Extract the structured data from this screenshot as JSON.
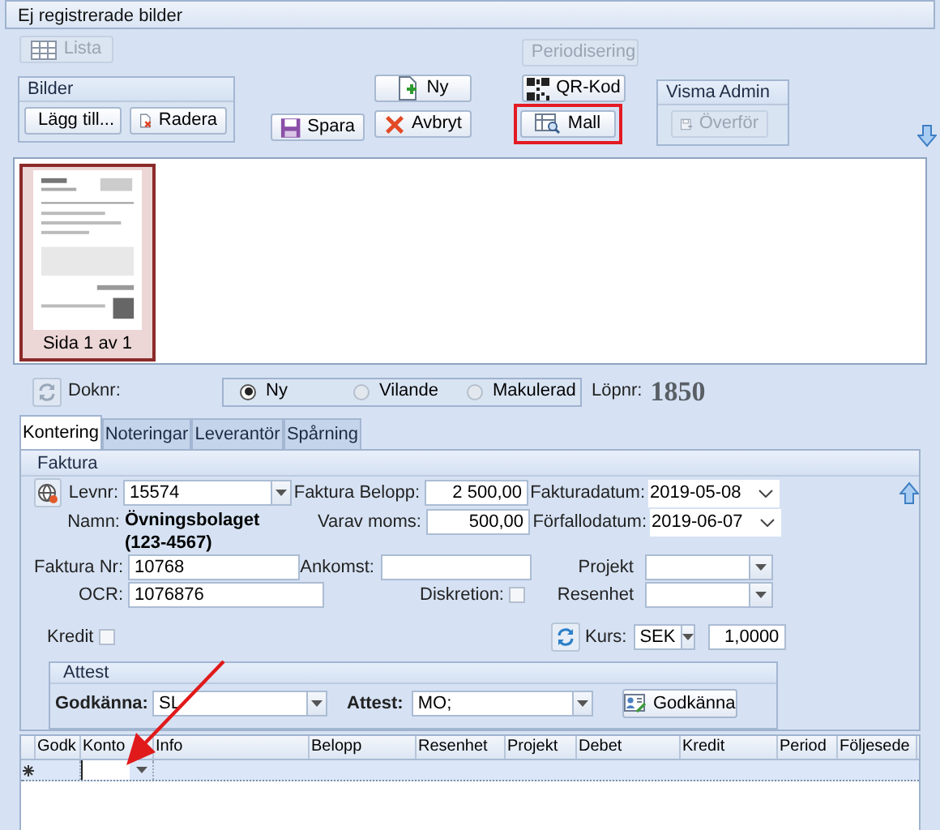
{
  "window": {
    "title": "Ej registrerade bilder"
  },
  "toolbar": {
    "lista": {
      "label": "Lista",
      "disabled": true
    },
    "bilder": {
      "title": "Bilder",
      "lagg_till": {
        "label": "Lägg till...",
        "disabled": false
      },
      "radera": {
        "label": "Radera",
        "disabled": false
      }
    },
    "spara": {
      "label": "Spara",
      "disabled": false
    },
    "ny": {
      "label": "Ny",
      "disabled": false
    },
    "avbryt": {
      "label": "Avbryt",
      "disabled": false
    },
    "periodisering": {
      "label": "Periodisering",
      "disabled": true
    },
    "qr_kod": {
      "label": "QR-Kod",
      "disabled": false
    },
    "mall": {
      "label": "Mall",
      "disabled": false,
      "highlighted": true
    },
    "visma_admin": {
      "title": "Visma Admin",
      "overfor": {
        "label": "Överför",
        "disabled": true
      }
    }
  },
  "preview": {
    "pages": [
      {
        "label": "Sida 1 av 1",
        "selected": true
      }
    ]
  },
  "document": {
    "doknr_label": "Doknr:",
    "status_options": [
      {
        "label": "Ny",
        "selected": true
      },
      {
        "label": "Vilande",
        "selected": false
      },
      {
        "label": "Makulerad",
        "selected": false
      }
    ],
    "lopnr_label": "Löpnr:",
    "lopnr": "1850"
  },
  "tabs": [
    {
      "label": "Kontering",
      "selected": true
    },
    {
      "label": "Noteringar",
      "selected": false
    },
    {
      "label": "Leverantör",
      "selected": false
    },
    {
      "label": "Spårning",
      "selected": false
    }
  ],
  "faktura": {
    "title": "Faktura",
    "levnr": {
      "label": "Levnr:",
      "value": "15574"
    },
    "faktura_belopp": {
      "label": "Faktura Belopp:",
      "value": "2 500,00"
    },
    "fakturadatum": {
      "label": "Fakturadatum:",
      "value": "2019-05-08"
    },
    "namn": {
      "label": "Namn:",
      "value": "Övningsbolaget (123-4567)"
    },
    "varav_moms": {
      "label": "Varav moms:",
      "value": "500,00"
    },
    "forfallodatum": {
      "label": "Förfallodatum:",
      "value": "2019-06-07"
    },
    "faktura_nr": {
      "label": "Faktura Nr:",
      "value": "10768"
    },
    "ankomst": {
      "label": "Ankomst:"
    },
    "projekt": {
      "label": "Projekt"
    },
    "ocr": {
      "label": "OCR:",
      "value": "1076876"
    },
    "diskretion": {
      "label": "Diskretion:",
      "checked": false
    },
    "resenhet": {
      "label": "Resenhet"
    },
    "kredit": {
      "label": "Kredit",
      "checked": false
    },
    "kurs": {
      "label": "Kurs:",
      "currency": "SEK",
      "rate": "1,0000"
    }
  },
  "attest": {
    "title": "Attest",
    "godkanna": {
      "label": "Godkänna:",
      "value": "SL"
    },
    "attest": {
      "label": "Attest:",
      "value": "MO;"
    },
    "button": {
      "label": "Godkänna"
    }
  },
  "grid": {
    "columns": [
      "Godk",
      "Konto",
      "Info",
      "Belopp",
      "Resenhet",
      "Projekt",
      "Debet",
      "Kredit",
      "Period",
      "Följesede"
    ]
  }
}
